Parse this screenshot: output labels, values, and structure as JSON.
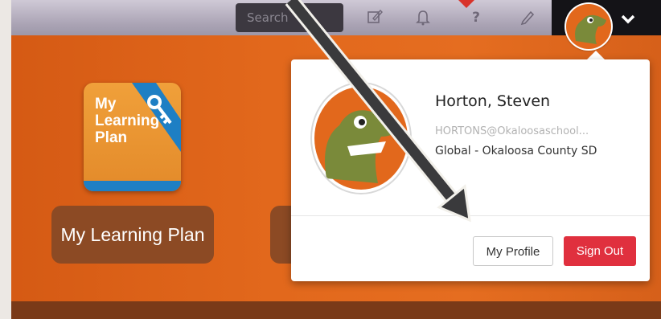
{
  "topbar": {
    "search_placeholder": "Search",
    "icons": [
      "compose-icon",
      "bell-icon",
      "help-icon",
      "pencil-icon"
    ],
    "help_glyph": "?"
  },
  "app_tile": {
    "icon_text_line1": "My",
    "icon_text_line2": "Learning",
    "icon_text_line3": "Plan",
    "label": "My Learning Plan"
  },
  "profile": {
    "name": "Horton, Steven",
    "email": "HORTONS@Okaloosaschool...",
    "organization": "Global - Okaloosa County SD",
    "my_profile_label": "My Profile",
    "sign_out_label": "Sign Out"
  },
  "colors": {
    "orange_bg": "#e2681c",
    "signout_red": "#e0303e",
    "topbar": "#aaa3b4"
  }
}
